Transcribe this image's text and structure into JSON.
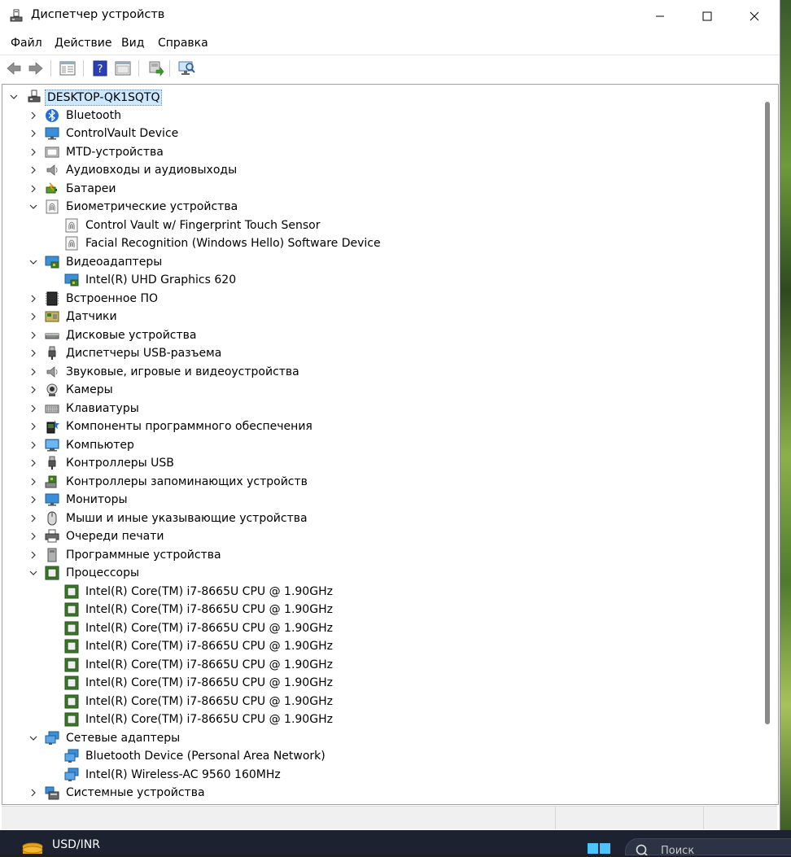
{
  "window": {
    "title": "Диспетчер устройств"
  },
  "menu": {
    "file": "Файл",
    "action": "Действие",
    "view": "Вид",
    "help": "Справка"
  },
  "tree": {
    "root": "DESKTOP-QK1SQTQ",
    "items": [
      {
        "label": "Bluetooth",
        "level": 1,
        "expanded": false,
        "icon": "bluetooth-icon"
      },
      {
        "label": "ControlVault Device",
        "level": 1,
        "expanded": false,
        "icon": "monitor-icon"
      },
      {
        "label": "MTD-устройства",
        "level": 1,
        "expanded": false,
        "icon": "mtd-device-icon"
      },
      {
        "label": "Аудиовходы и аудиовыходы",
        "level": 1,
        "expanded": false,
        "icon": "speaker-icon"
      },
      {
        "label": "Батареи",
        "level": 1,
        "expanded": false,
        "icon": "battery-icon"
      },
      {
        "label": "Биометрические устройства",
        "level": 1,
        "expanded": true,
        "icon": "fingerprint-icon"
      },
      {
        "label": "Control Vault w/ Fingerprint Touch Sensor",
        "level": 2,
        "icon": "fingerprint-icon"
      },
      {
        "label": "Facial Recognition (Windows Hello) Software Device",
        "level": 2,
        "icon": "fingerprint-icon"
      },
      {
        "label": "Видеоадаптеры",
        "level": 1,
        "expanded": true,
        "icon": "display-adapter-icon"
      },
      {
        "label": "Intel(R) UHD Graphics 620",
        "level": 2,
        "icon": "display-adapter-icon"
      },
      {
        "label": "Встроенное ПО",
        "level": 1,
        "expanded": false,
        "icon": "firmware-icon"
      },
      {
        "label": "Датчики",
        "level": 1,
        "expanded": false,
        "icon": "sensor-icon"
      },
      {
        "label": "Дисковые устройства",
        "level": 1,
        "expanded": false,
        "icon": "disk-drive-icon"
      },
      {
        "label": "Диспетчеры USB-разъема",
        "level": 1,
        "expanded": false,
        "icon": "usb-connector-icon"
      },
      {
        "label": "Звуковые, игровые и видеоустройства",
        "level": 1,
        "expanded": false,
        "icon": "speaker-icon"
      },
      {
        "label": "Камеры",
        "level": 1,
        "expanded": false,
        "icon": "camera-icon"
      },
      {
        "label": "Клавиатуры",
        "level": 1,
        "expanded": false,
        "icon": "keyboard-icon"
      },
      {
        "label": "Компоненты программного обеспечения",
        "level": 1,
        "expanded": false,
        "icon": "software-component-icon"
      },
      {
        "label": "Компьютер",
        "level": 1,
        "expanded": false,
        "icon": "computer-icon"
      },
      {
        "label": "Контроллеры USB",
        "level": 1,
        "expanded": false,
        "icon": "usb-connector-icon"
      },
      {
        "label": "Контроллеры запоминающих устройств",
        "level": 1,
        "expanded": false,
        "icon": "storage-controller-icon"
      },
      {
        "label": "Мониторы",
        "level": 1,
        "expanded": false,
        "icon": "monitor-icon"
      },
      {
        "label": "Мыши и иные указывающие устройства",
        "level": 1,
        "expanded": false,
        "icon": "mouse-icon"
      },
      {
        "label": "Очереди печати",
        "level": 1,
        "expanded": false,
        "icon": "printer-icon"
      },
      {
        "label": "Программные устройства",
        "level": 1,
        "expanded": false,
        "icon": "software-device-icon"
      },
      {
        "label": "Процессоры",
        "level": 1,
        "expanded": true,
        "icon": "processor-icon"
      },
      {
        "label": "Intel(R) Core(TM) i7-8665U CPU @ 1.90GHz",
        "level": 2,
        "icon": "processor-icon"
      },
      {
        "label": "Intel(R) Core(TM) i7-8665U CPU @ 1.90GHz",
        "level": 2,
        "icon": "processor-icon"
      },
      {
        "label": "Intel(R) Core(TM) i7-8665U CPU @ 1.90GHz",
        "level": 2,
        "icon": "processor-icon"
      },
      {
        "label": "Intel(R) Core(TM) i7-8665U CPU @ 1.90GHz",
        "level": 2,
        "icon": "processor-icon"
      },
      {
        "label": "Intel(R) Core(TM) i7-8665U CPU @ 1.90GHz",
        "level": 2,
        "icon": "processor-icon"
      },
      {
        "label": "Intel(R) Core(TM) i7-8665U CPU @ 1.90GHz",
        "level": 2,
        "icon": "processor-icon"
      },
      {
        "label": "Intel(R) Core(TM) i7-8665U CPU @ 1.90GHz",
        "level": 2,
        "icon": "processor-icon"
      },
      {
        "label": "Intel(R) Core(TM) i7-8665U CPU @ 1.90GHz",
        "level": 2,
        "icon": "processor-icon"
      },
      {
        "label": "Сетевые адаптеры",
        "level": 1,
        "expanded": true,
        "icon": "network-adapter-icon"
      },
      {
        "label": "Bluetooth Device (Personal Area Network)",
        "level": 2,
        "icon": "network-adapter-icon"
      },
      {
        "label": "Intel(R) Wireless-AC 9560 160MHz",
        "level": 2,
        "icon": "network-adapter-icon"
      },
      {
        "label": "Системные устройства",
        "level": 1,
        "expanded": false,
        "icon": "system-device-icon"
      }
    ]
  },
  "taskbar": {
    "ticker": "USD/INR",
    "search_placeholder": "Поиск"
  },
  "colors": {
    "selection": "#cce8ff",
    "taskbar": "#1c2230",
    "accent": "#0078d4"
  }
}
